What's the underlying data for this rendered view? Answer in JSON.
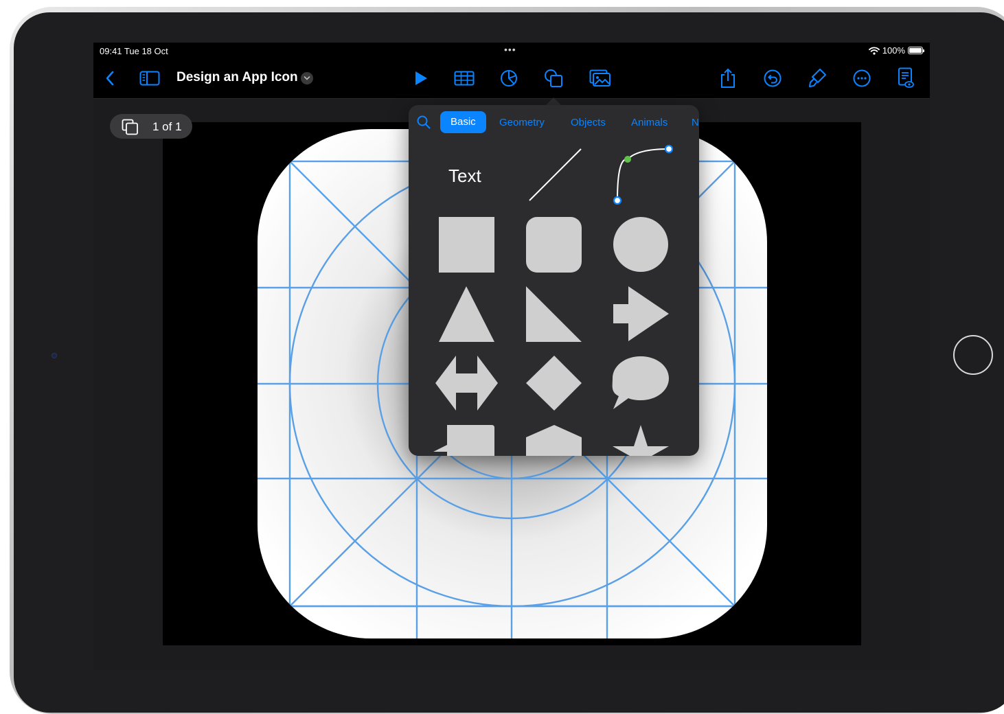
{
  "status_bar": {
    "time_date": "09:41  Tue 18 Oct",
    "multitask_dots": "•••",
    "battery_percent": "100%"
  },
  "toolbar": {
    "document_title": "Design an App Icon",
    "icons": [
      "back-chevron-icon",
      "sidebar-icon",
      "play-icon",
      "table-icon",
      "chart-icon",
      "shapes-icon",
      "media-icon",
      "share-icon",
      "undo-icon",
      "format-brush-icon",
      "more-icon",
      "presenter-view-icon"
    ]
  },
  "page_indicator": {
    "label": "1 of 1"
  },
  "shapes_popover": {
    "tabs": [
      {
        "label": "Basic",
        "selected": true
      },
      {
        "label": "Geometry"
      },
      {
        "label": "Objects"
      },
      {
        "label": "Animals"
      },
      {
        "label": "N"
      }
    ],
    "text_item": "Text",
    "shapes": [
      "line",
      "curve",
      "square",
      "rounded-square",
      "circle",
      "triangle",
      "right-triangle",
      "arrow-right",
      "double-arrow",
      "diamond",
      "speech-bubble",
      "callout",
      "pentagon",
      "star"
    ]
  },
  "colors": {
    "accent": "#0a84ff",
    "guide_blue": "#5aa0e6",
    "shape_fill": "#cfcfcf",
    "popover_bg": "#2c2c2e"
  }
}
